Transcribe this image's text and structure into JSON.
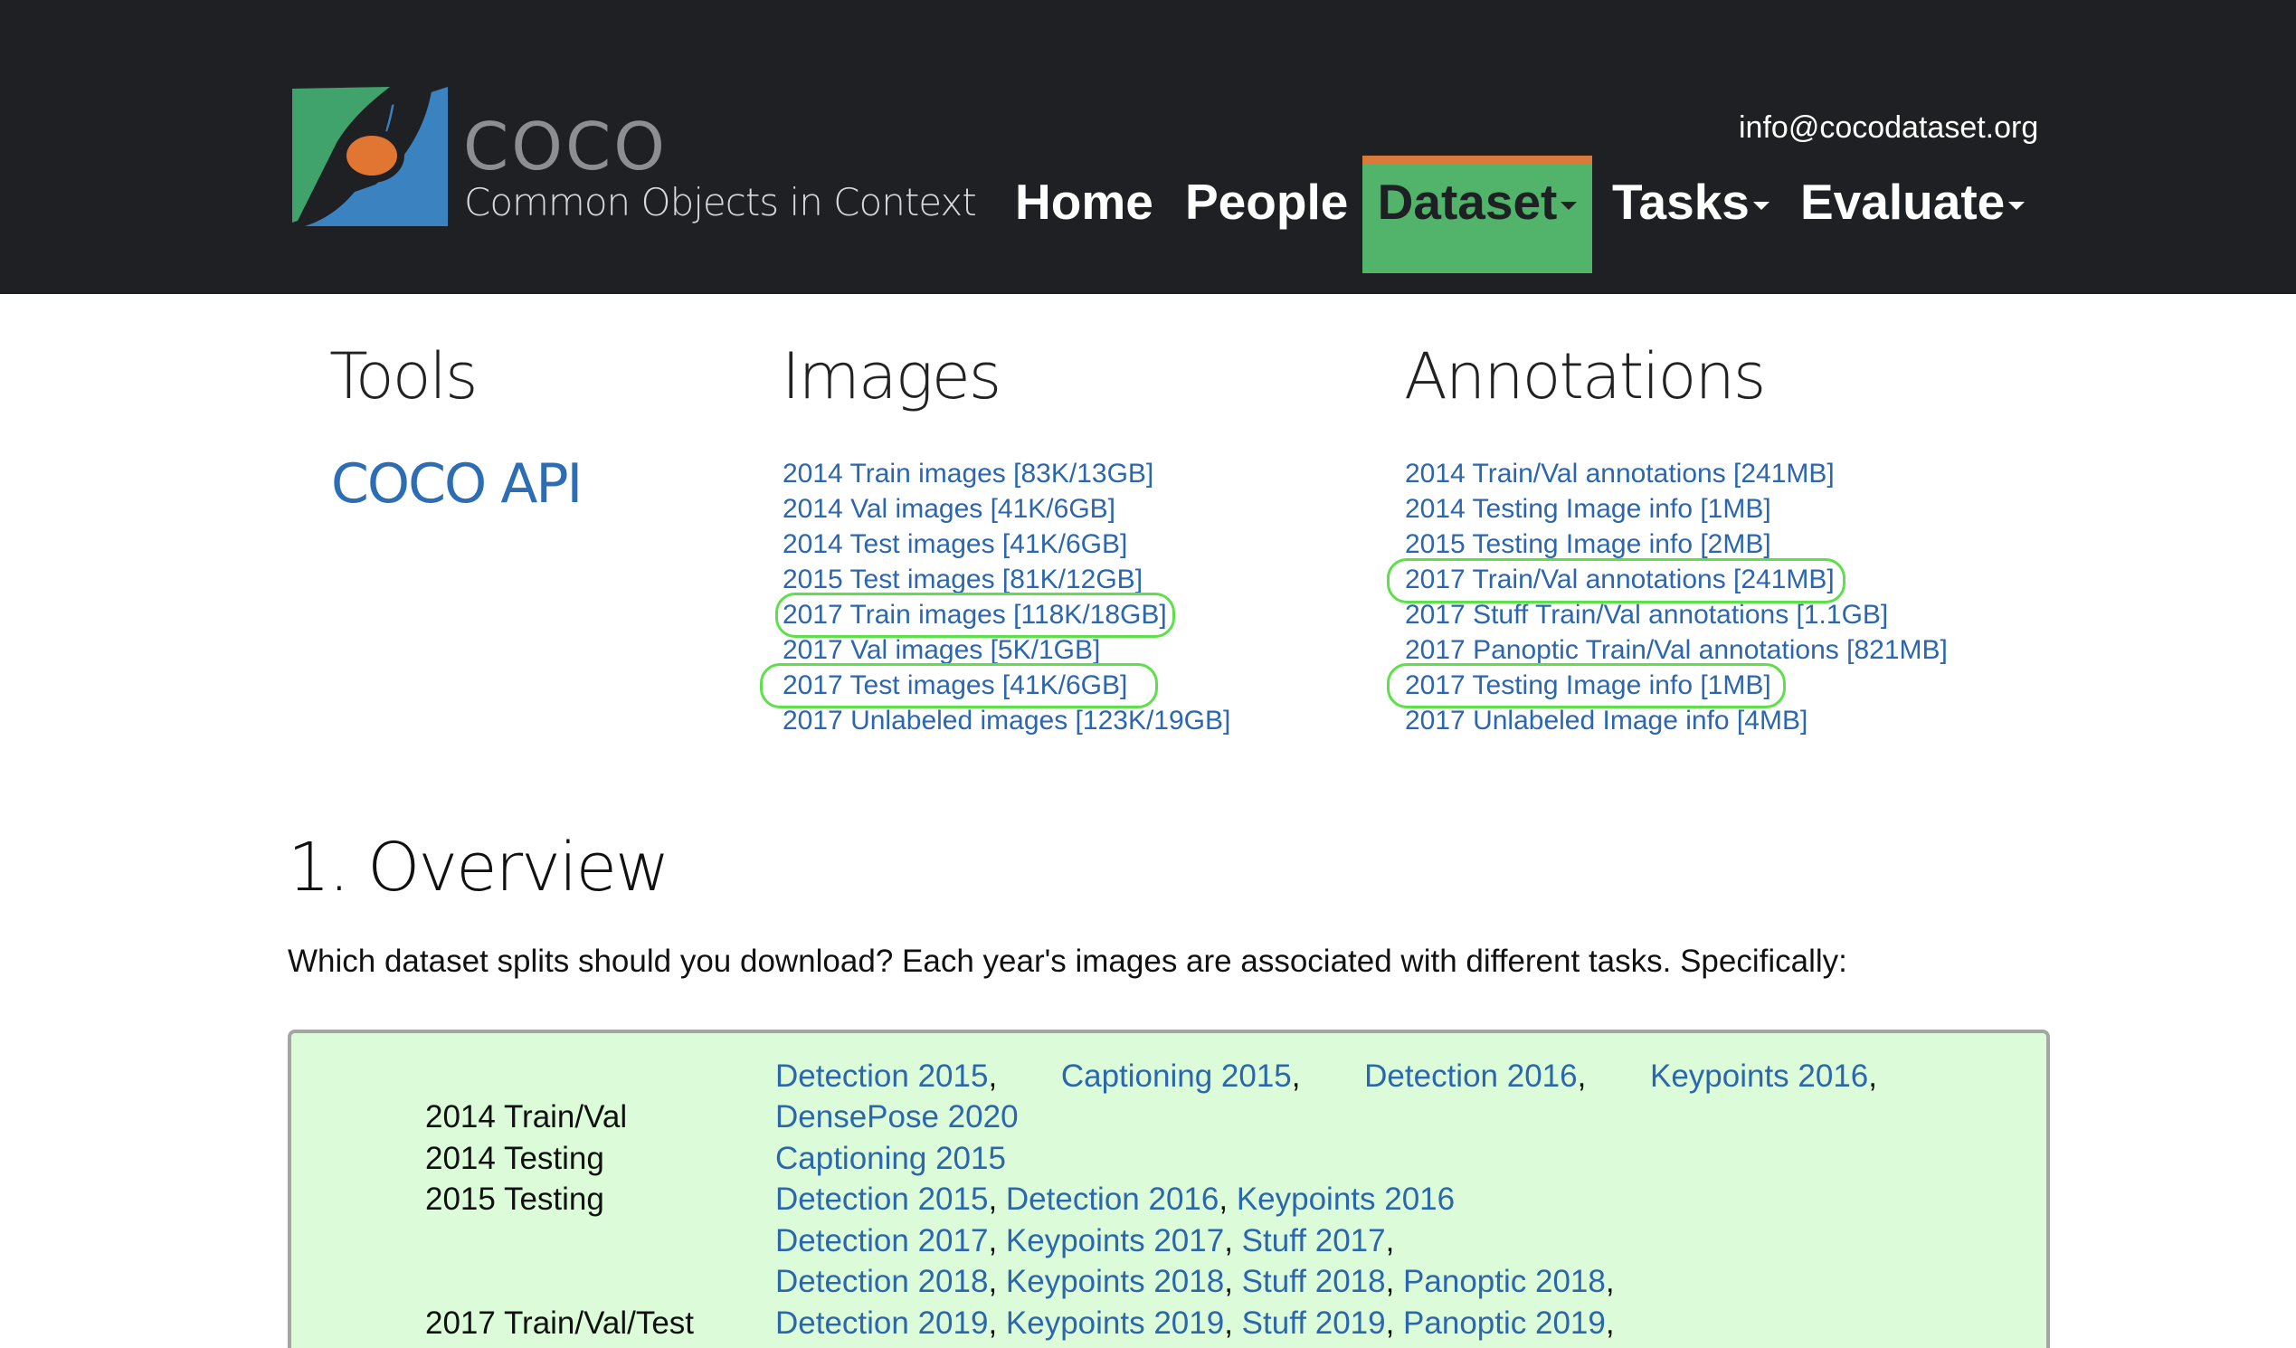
{
  "header": {
    "logo_title": "COCO",
    "logo_subtitle": "Common Objects in Context",
    "email": "info@cocodataset.org",
    "nav": {
      "home": "Home",
      "people": "People",
      "dataset": "Dataset",
      "tasks": "Tasks",
      "evaluate": "Evaluate"
    },
    "colors": {
      "background": "#1e2023",
      "active_tab": "#52b36b",
      "active_tab_top": "#d87b3a"
    }
  },
  "tools": {
    "title": "Tools",
    "coco_api": "COCO API"
  },
  "images": {
    "title": "Images",
    "links": [
      "2014 Train images [83K/13GB]",
      "2014 Val images [41K/6GB]",
      "2014 Test images [41K/6GB]",
      "2015 Test images [81K/12GB]",
      "2017 Train images [118K/18GB]",
      "2017 Val images [5K/1GB]",
      "2017 Test images [41K/6GB]",
      "2017 Unlabeled images [123K/19GB]"
    ]
  },
  "annotations": {
    "title": "Annotations",
    "links": [
      "2014 Train/Val annotations [241MB]",
      "2014 Testing Image info [1MB]",
      "2015 Testing Image info [2MB]",
      "2017 Train/Val annotations [241MB]",
      "2017 Stuff Train/Val annotations [1.1GB]",
      "2017 Panoptic Train/Val annotations [821MB]",
      "2017 Testing Image info [1MB]",
      "2017 Unlabeled Image info [4MB]"
    ]
  },
  "overview": {
    "title": "1. Overview",
    "text": "Which dataset splits should you download? Each year's images are associated with different tasks. Specifically:",
    "splits": {
      "s2014_trainval": "2014 Train/Val",
      "s2014_testing": "2014 Testing",
      "s2015_testing": "2015 Testing",
      "s2017_trainvaltest": "2017 Train/Val/Test"
    },
    "tasks": {
      "r1": [
        "Detection 2015",
        "Captioning 2015",
        "Detection 2016",
        "Keypoints 2016"
      ],
      "r2": [
        "DensePose 2020"
      ],
      "r3": [
        "Captioning 2015"
      ],
      "r4": [
        "Detection 2015",
        "Detection 2016",
        "Keypoints 2016"
      ],
      "r5": [
        "Detection 2017",
        "Keypoints 2017",
        "Stuff 2017"
      ],
      "r6": [
        "Detection 2018",
        "Keypoints 2018",
        "Stuff 2018",
        "Panoptic 2018"
      ],
      "r7": [
        "Detection 2019",
        "Keypoints 2019",
        "Stuff 2019",
        "Panoptic 2019"
      ]
    }
  },
  "highlight_color": "#5ee04a",
  "link_color": "#2b66ae"
}
